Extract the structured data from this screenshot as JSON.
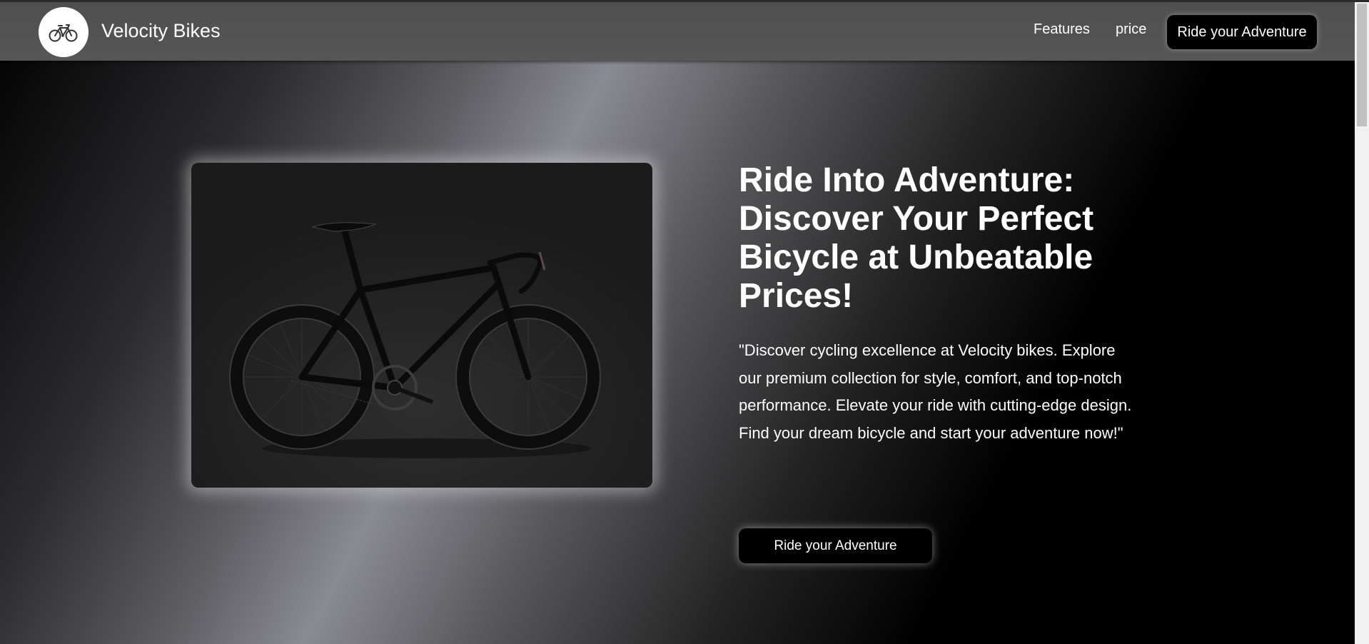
{
  "navbar": {
    "logo_icon": "bicycle-icon",
    "brand": "Velocity Bikes",
    "links": [
      {
        "label": "Features"
      },
      {
        "label": "price"
      }
    ],
    "cta_label": "Ride your Adventure"
  },
  "hero": {
    "image_icon": "bicycle-photo",
    "title": "Ride Into Adventure: Discover Your Perfect Bicycle at Unbeatable Prices!",
    "description": "\"Discover cycling excellence at Velocity bikes. Explore our premium collection for style, comfort, and top-notch performance. Elevate your ride with cutting-edge design. Find your dream bicycle and start your adventure now!\"",
    "cta_label": "Ride your Adventure"
  },
  "colors": {
    "navbar": "#525252",
    "button": "#000000",
    "text": "#ffffff"
  }
}
